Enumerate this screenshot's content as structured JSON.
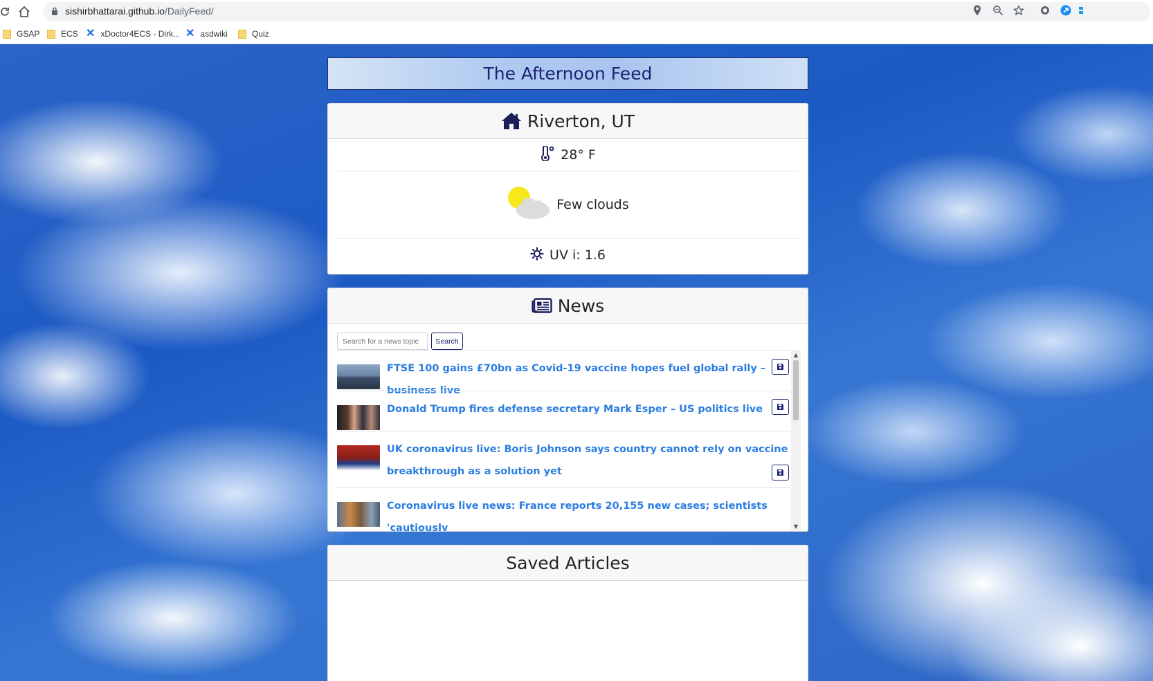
{
  "browser": {
    "url_host": "sishirbhattarai.github.io",
    "url_path": "/DailyFeed/",
    "bookmarks": [
      {
        "label": "GSAP",
        "icon": "folder-icon"
      },
      {
        "label": "ECS",
        "icon": "folder-icon"
      },
      {
        "label": "xDoctor4ECS - Dirk...",
        "icon": "confluence-icon"
      },
      {
        "label": "asdwiki",
        "icon": "confluence-icon"
      },
      {
        "label": "Quiz",
        "icon": "folder-icon"
      }
    ]
  },
  "app": {
    "title": "The Afternoon Feed"
  },
  "weather": {
    "location": "Riverton, UT",
    "temperature": "28° F",
    "condition": "Few clouds",
    "uv": "UV i: 1.6",
    "colors": {
      "sun": "#f7e81c",
      "cloud": "#dcdcdc"
    }
  },
  "news": {
    "heading": "News",
    "search_placeholder": "Search for a news topic",
    "search_label": "Search",
    "articles": [
      {
        "title": "FTSE 100 gains £70bn as Covid-19 vaccine hopes fuel global rally – business live"
      },
      {
        "title": "Donald Trump fires defense secretary Mark Esper – US politics live"
      },
      {
        "title": "UK coronavirus live: Boris Johnson says country cannot rely on vaccine breakthrough as a solution yet"
      },
      {
        "title": "Coronavirus live news: France reports 20,155 new cases; scientists 'cautiously"
      }
    ]
  },
  "saved": {
    "heading": "Saved Articles"
  },
  "colors": {
    "accent": "#1d2473",
    "link": "#2a7de1"
  }
}
